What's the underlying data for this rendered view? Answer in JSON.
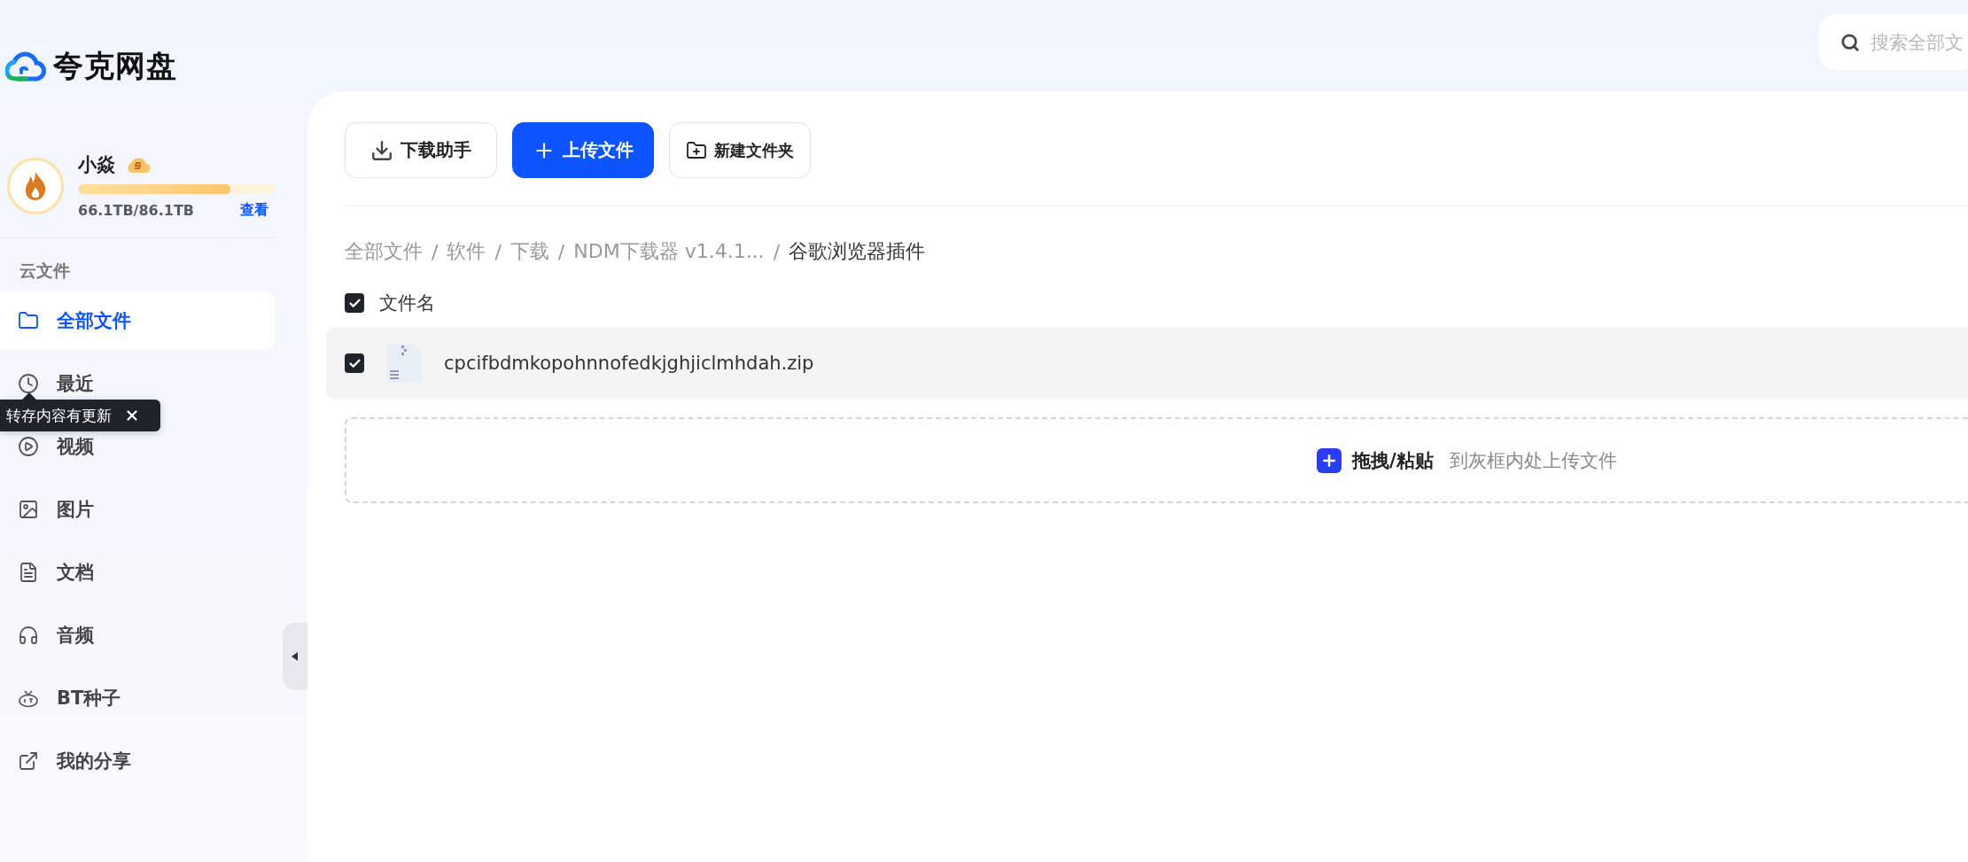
{
  "app": {
    "name": "夸克网盘"
  },
  "search": {
    "placeholder": "搜索全部文"
  },
  "user": {
    "name": "小焱",
    "vip": true,
    "storage": {
      "level": 0.77,
      "reading": "66.1TB/86.1TB",
      "link": "查看"
    }
  },
  "sidebar": {
    "section": "云文件",
    "items": [
      {
        "label": "全部文件",
        "kind": "folder",
        "selected": true
      },
      {
        "label": "最近",
        "kind": "recent",
        "selected": false
      },
      {
        "label": "视频",
        "kind": "video",
        "selected": false
      },
      {
        "label": "图片",
        "kind": "image",
        "selected": false
      },
      {
        "label": "文档",
        "kind": "document",
        "selected": false
      },
      {
        "label": "音频",
        "kind": "audio",
        "selected": false
      },
      {
        "label": "BT种子",
        "kind": "torrent",
        "selected": false
      },
      {
        "label": "我的分享",
        "kind": "share",
        "selected": false
      }
    ]
  },
  "tooltip": {
    "text": "转存内容有更新"
  },
  "toolbar": {
    "buttons": [
      {
        "label": "下载助手",
        "kind": "download"
      },
      {
        "label": "上传文件",
        "kind": "upload"
      },
      {
        "label": "新建文件夹",
        "kind": "new-folder"
      }
    ]
  },
  "breadcrumb": [
    {
      "label": "全部文件",
      "current": false
    },
    {
      "separator": "/",
      "label": "软件",
      "current": false
    },
    {
      "separator": "/",
      "label": "下载",
      "current": false
    },
    {
      "separator": "/",
      "label": "NDM下载器 v1.4.1...",
      "current": false
    },
    {
      "separator": "/",
      "label": "谷歌浏览器插件",
      "current": true
    }
  ],
  "file_list": {
    "header": {
      "label": "文件名",
      "checked": true
    },
    "rows": [
      {
        "name": "cpcifbdmkopohnnofedkjghjiclmhdah.zip",
        "checked": true
      }
    ]
  },
  "dropzone": {
    "action": "拖拽/粘贴",
    "hint": "到灰框内处上传文件"
  }
}
